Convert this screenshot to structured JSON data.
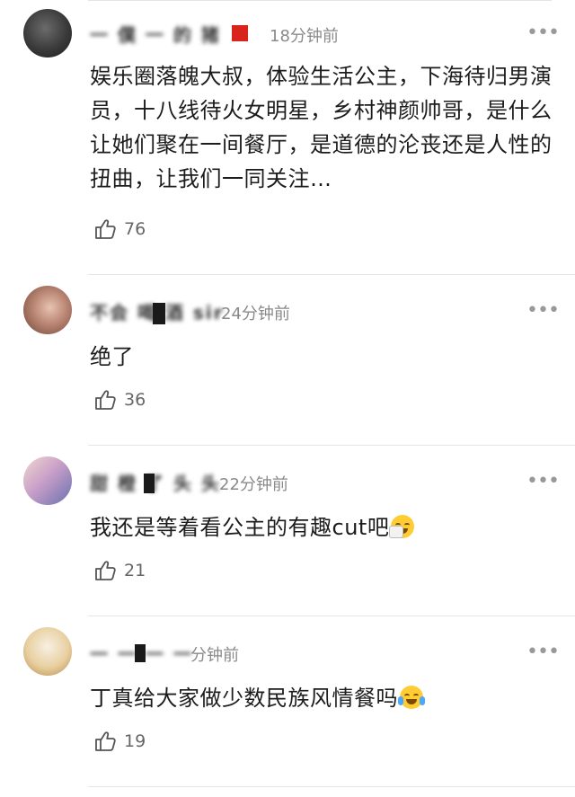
{
  "comments": [
    {
      "username": "一 僕 一 的 猪",
      "time": "18分钟前",
      "text": "娱乐圈落魄大叔，体验生活公主，下海待归男演员，十八线待火女明星，乡村神颜帅哥，是什么让她们聚在一间餐厅，是道德的沦丧还是人性的扭曲，让我们一同关注…",
      "likes": "76",
      "more_icon": "more-icon"
    },
    {
      "username": "不会 喝 酒 sir",
      "time": "24分钟前",
      "text": "绝了",
      "likes": "36",
      "more_icon": "more-icon"
    },
    {
      "username": "甜 橙 了 头 头",
      "time": "22分钟前",
      "text": "我还是等着看公主的有趣cut吧",
      "emoji": "sneezing-face",
      "likes": "21",
      "more_icon": "more-icon"
    },
    {
      "username": "一 一 一 一",
      "time": "分钟前",
      "text": "丁真给大家做少数民族风情餐吗",
      "emoji": "tears-of-joy-face",
      "likes": "19",
      "more_icon": "more-icon"
    }
  ],
  "icons": {
    "like": "thumbs-up-icon",
    "more": "more-icon"
  }
}
